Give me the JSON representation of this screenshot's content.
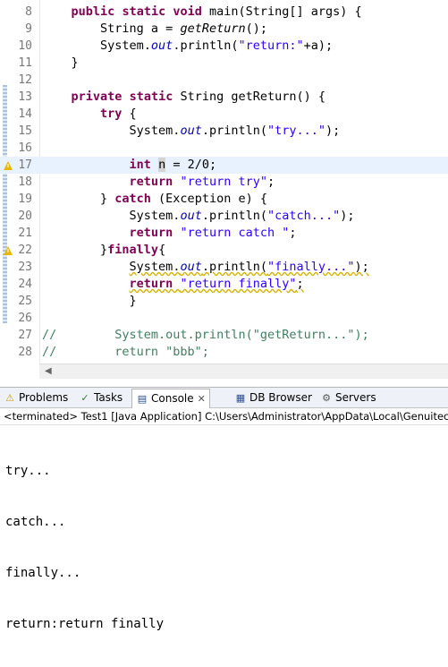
{
  "editor": {
    "lines": [
      {
        "n": "8",
        "html": "    <span class='kw'>public</span> <span class='kw'>static</span> <span class='kw'>void</span> main(String[] args) {"
      },
      {
        "n": "9",
        "html": "        String a = <span class='ital'>getReturn</span>();"
      },
      {
        "n": "10",
        "html": "        System.<span class='field'>out</span>.println(<span class='str'>\"return:\"</span>+a);"
      },
      {
        "n": "11",
        "html": "    }"
      },
      {
        "n": "12",
        "html": ""
      },
      {
        "n": "13",
        "html": "    <span class='kw'>private</span> <span class='kw'>static</span> String getReturn() {"
      },
      {
        "n": "14",
        "html": "        <span class='kw'>try</span> {"
      },
      {
        "n": "15",
        "html": "            System.<span class='field'>out</span>.println(<span class='str'>\"try...\"</span>);"
      },
      {
        "n": "16",
        "html": ""
      },
      {
        "n": "17",
        "html": "            <span class='kw'>int</span> <span class='hl'>n</span> = 2/0;",
        "current": true
      },
      {
        "n": "18",
        "html": "            <span class='kw'>return</span> <span class='str'>\"return try\"</span>;"
      },
      {
        "n": "19",
        "html": "        } <span class='kw'>catch</span> (Exception e) {"
      },
      {
        "n": "20",
        "html": "            System.<span class='field'>out</span>.println(<span class='str'>\"catch...\"</span>);"
      },
      {
        "n": "21",
        "html": "            <span class='kw'>return</span> <span class='str'>\"return catch \"</span>;"
      },
      {
        "n": "22",
        "html": "        }<span class='kw'>finally</span>{"
      },
      {
        "n": "23",
        "html": "            <span class='warn'>System.<span class='field'>out</span>.println(<span class='str'>\"finally...\"</span>);</span>"
      },
      {
        "n": "24",
        "html": "            <span class='warn'><span class='kw'>return</span> <span class='str'>\"return finally\"</span>;</span>"
      },
      {
        "n": "25",
        "html": "            }"
      },
      {
        "n": "26",
        "html": ""
      },
      {
        "n": "27",
        "html": "<span class='cmt'>//        System.out.println(\"getReturn...\");</span>"
      },
      {
        "n": "28",
        "html": "<span class='cmt'>//        return \"bbb\";</span>"
      }
    ]
  },
  "panel": {
    "tabs": [
      {
        "label": "Problems",
        "icon": "problems-icon",
        "glyph": "⚠"
      },
      {
        "label": "Tasks",
        "icon": "tasks-icon",
        "glyph": "✓"
      },
      {
        "label": "Console",
        "icon": "console-icon",
        "glyph": "▤",
        "active": true
      },
      {
        "label": "DB Browser",
        "icon": "db-browser-icon",
        "glyph": "▦"
      },
      {
        "label": "Servers",
        "icon": "servers-icon",
        "glyph": "⚙"
      }
    ],
    "status": "<terminated> Test1 [Java Application] C:\\Users\\Administrator\\AppData\\Local\\Genuitec",
    "output": [
      "try...",
      "catch...",
      "finally...",
      "return:return finally"
    ]
  }
}
